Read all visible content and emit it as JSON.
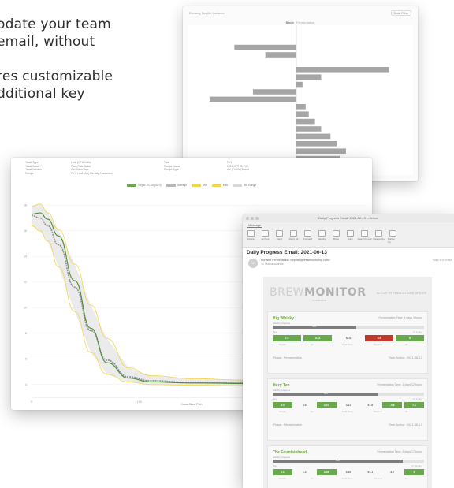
{
  "background_text": [
    "odate your team",
    "email, without",
    ".",
    "res customizable",
    "dditional key"
  ],
  "bar_report": {
    "title": "Brewing Quality Variance",
    "button": "Date Filter",
    "subtitle": "Batch",
    "subtitle_muted": "Fermentation",
    "chart_data": {
      "type": "bar",
      "orientation": "horizontal",
      "series": [
        {
          "values": [
            0,
            0,
            -1.0,
            -0.5,
            0,
            1.5,
            0.4,
            0.1,
            -0.7,
            -1.4,
            0.15,
            0.2,
            0.3,
            0.4,
            0.55,
            0.65,
            0.8,
            0.7,
            0.2
          ]
        }
      ],
      "colors": {
        "bar": "#a6a6a6",
        "axis": "#cfcfcf"
      }
    }
  },
  "line_chart": {
    "meta": [
      [
        "Yeast Type",
        "Limit (CFU/Cells)",
        "Tank",
        "FV1"
      ],
      [
        "Yeast Batch",
        "Pitch Rate Batch",
        "Recipe Name",
        "2021 CFT 21 FV1"
      ],
      [
        "Yeast Number",
        "Gen Data Rate",
        "Recipe Type",
        "Ale (Profile) Brand"
      ],
      [
        "Recipe",
        "FV 2 Limit (Ale) Density Customers",
        "",
        ""
      ]
    ],
    "legend": [
      {
        "label": "Target: 21-05 (42.0)",
        "color": "#6aa84f"
      },
      {
        "label": "Average",
        "color": "#b7b7b7"
      },
      {
        "label": "Min",
        "color": "#f1d54a"
      },
      {
        "label": "Max",
        "color": "#f1d54a"
      },
      {
        "label": "Std Range",
        "color": "#d9d9d9"
      }
    ],
    "xlabel": "Hours Since Pitch",
    "chart_data": {
      "type": "line",
      "xlabel": "Hours Since Pitch",
      "ylabel": "",
      "x_ticks": [
        0,
        100,
        200,
        300
      ],
      "y_ticks": [
        4,
        6,
        8,
        10,
        12,
        14,
        16,
        18
      ],
      "xlim": [
        0,
        310
      ],
      "ylim": [
        3,
        19
      ],
      "series": [
        {
          "name": "Average",
          "color": "#909090",
          "x": [
            0,
            8,
            15,
            25,
            40,
            55,
            70,
            90,
            110,
            150,
            200,
            250,
            300
          ],
          "y": [
            17.2,
            17.0,
            16.4,
            14.9,
            11.6,
            8.2,
            5.9,
            4.6,
            4.3,
            4.15,
            4.1,
            4.08,
            4.05
          ]
        },
        {
          "name": "Max",
          "color": "#f1d54a",
          "x": [
            0,
            8,
            15,
            25,
            40,
            55,
            70,
            90,
            110,
            150,
            200,
            250,
            300
          ],
          "y": [
            17.9,
            18.1,
            17.4,
            16.1,
            13.4,
            10.2,
            7.6,
            5.3,
            4.7,
            4.45,
            4.35,
            4.4,
            4.2
          ]
        },
        {
          "name": "Min",
          "color": "#f1d54a",
          "x": [
            0,
            8,
            15,
            25,
            40,
            55,
            70,
            90,
            110,
            150,
            200,
            250,
            300
          ],
          "y": [
            16.4,
            16.0,
            15.2,
            13.2,
            9.7,
            6.5,
            4.8,
            4.2,
            4.0,
            3.95,
            3.9,
            3.85,
            3.85
          ]
        },
        {
          "name": "Target: 21-05 (42.0)",
          "color": "#4e8a38",
          "x": [
            0,
            8,
            15,
            25,
            40,
            55,
            70,
            90,
            110,
            150,
            200,
            250,
            300
          ],
          "y": [
            17.3,
            17.4,
            16.9,
            15.6,
            12.1,
            8.4,
            5.7,
            4.5,
            4.2,
            4.12,
            4.08,
            4.05,
            4.0
          ]
        }
      ]
    }
  },
  "email": {
    "window_title": "Daily Progress Email: 2021-06-13 — Inbox",
    "tab": "Message",
    "tools": [
      "Delete",
      "Archive",
      "Reply",
      "Reply All",
      "Forward",
      "Meeting",
      "Move",
      "Junk",
      "Read/Unread",
      "Categorize",
      "Follow Up"
    ],
    "subject": "Daily Progress Email: 2021-06-13",
    "avatar_initials": "OE",
    "from": "Portable Fermentation <reports@brewmonitoring.com>",
    "to": "To: Outlook Address",
    "date": "Today at 6:00 AM",
    "brand_main": "BREW",
    "brand_bold": "MONITOR",
    "brand_sub": "COMMAND",
    "brand_update": "ACTIVE FERMENTATIONS UPDATE",
    "fermentations": [
      {
        "name": "Big Whisky",
        "time": "Fermentation Time: 8 days 1 hours",
        "activity": "Activity progress",
        "progress": 0.55,
        "progress_label": "54%",
        "day_label": "Day",
        "range_label": "0 / 2 days",
        "meters": [
          {
            "value": "7.6",
            "color": "#6aa84f"
          },
          {
            "value": "4.43",
            "color": "#6aa84f"
          },
          {
            "value": "82.6",
            "color": "plain"
          },
          {
            "value": "8.9",
            "color": "#c0392b"
          },
          {
            "value": "9",
            "color": "#6aa84f"
          }
        ],
        "labels": [
          "Gravity",
          "pH",
          "Fluid Temp",
          "Pressure",
          "Air"
        ],
        "status": "Phase: Fermentation",
        "time_remaining": "Time Active: 2021-06-13"
      },
      {
        "name": "Hazy Ten",
        "time": "Fermentation Time: 1 days 12 hours",
        "activity": "Activity progress",
        "progress": 0.7,
        "progress_label": "70%",
        "day_label": "Day",
        "range_label": "0 / 2 days",
        "meters": [
          {
            "value": "6.0",
            "color": "#6aa84f"
          },
          {
            "value": "4.6",
            "color": "plain"
          },
          {
            "value": "4.57",
            "color": "#6aa84f"
          },
          {
            "value": "3.11",
            "color": "plain"
          },
          {
            "value": "67.8",
            "color": "plain"
          },
          {
            "value": "-0.6",
            "color": "#6aa84f"
          },
          {
            "value": "7.1",
            "color": "#6aa84f"
          }
        ],
        "labels": [
          "Gravity",
          "pH",
          "Fluid Temp",
          "Pressure",
          "Air"
        ],
        "status": "Phase: Fermentation",
        "time_remaining": "Time Active: 2021-06-13"
      },
      {
        "name": "The Fountainhead",
        "time": "Fermentation Time: 9 days 17 hours",
        "activity": "Activity progress",
        "progress": 0.86,
        "progress_label": "85%",
        "day_label": "Day",
        "range_label": "0 / 10 days",
        "meters": [
          {
            "value": "2.1",
            "color": "#6aa84f"
          },
          {
            "value": "1.2",
            "color": "plain"
          },
          {
            "value": "3.49",
            "color": "#6aa84f"
          },
          {
            "value": "3.62",
            "color": "plain"
          },
          {
            "value": "61.1",
            "color": "plain"
          },
          {
            "value": "4.2",
            "color": "plain"
          },
          {
            "value": "0",
            "color": "#6aa84f"
          }
        ],
        "labels": [
          "Gravity",
          "pH",
          "Fluid Temp",
          "Pressure",
          "Air"
        ],
        "status": "Phase: Stationary",
        "time_remaining": "Time Active: 2021-06-13"
      }
    ]
  }
}
